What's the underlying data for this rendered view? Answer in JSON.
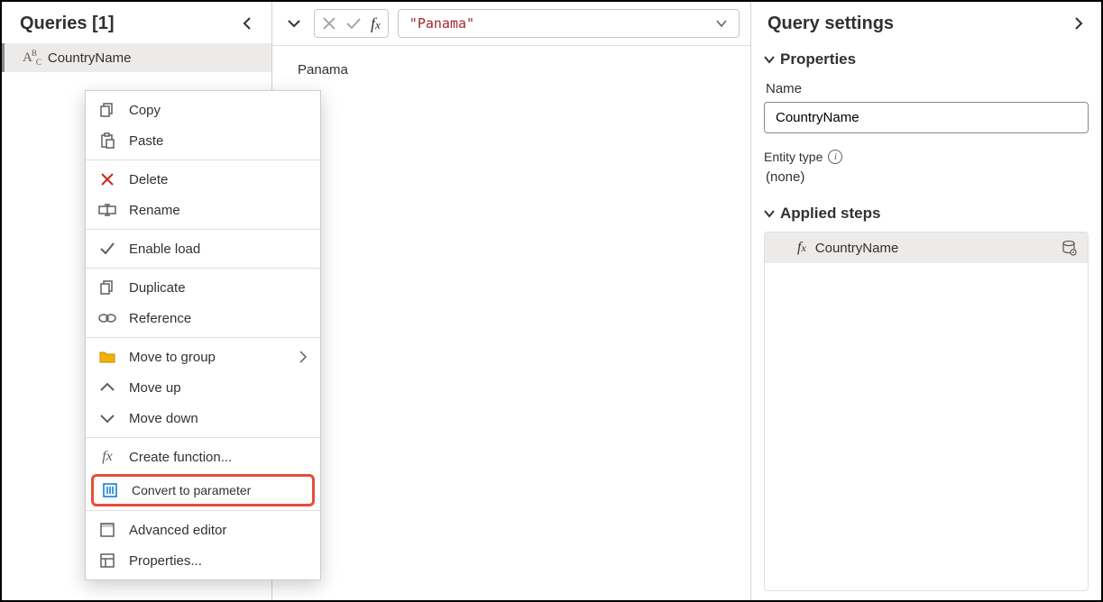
{
  "queries": {
    "title": "Queries [1]",
    "item": "CountryName"
  },
  "contextMenu": {
    "copy": "Copy",
    "paste": "Paste",
    "delete": "Delete",
    "rename": "Rename",
    "enableLoad": "Enable load",
    "duplicate": "Duplicate",
    "reference": "Reference",
    "moveToGroup": "Move to group",
    "moveUp": "Move up",
    "moveDown": "Move down",
    "createFunction": "Create function...",
    "convertToParameter": "Convert to parameter",
    "advancedEditor": "Advanced editor",
    "properties": "Properties..."
  },
  "formulaBar": {
    "value": "\"Panama\""
  },
  "preview": {
    "text": "Panama"
  },
  "settings": {
    "title": "Query settings",
    "propertiesSection": "Properties",
    "nameLabel": "Name",
    "nameValue": "CountryName",
    "entityTypeLabel": "Entity type",
    "entityTypeValue": "(none)",
    "appliedStepsSection": "Applied steps",
    "step1": "CountryName"
  }
}
